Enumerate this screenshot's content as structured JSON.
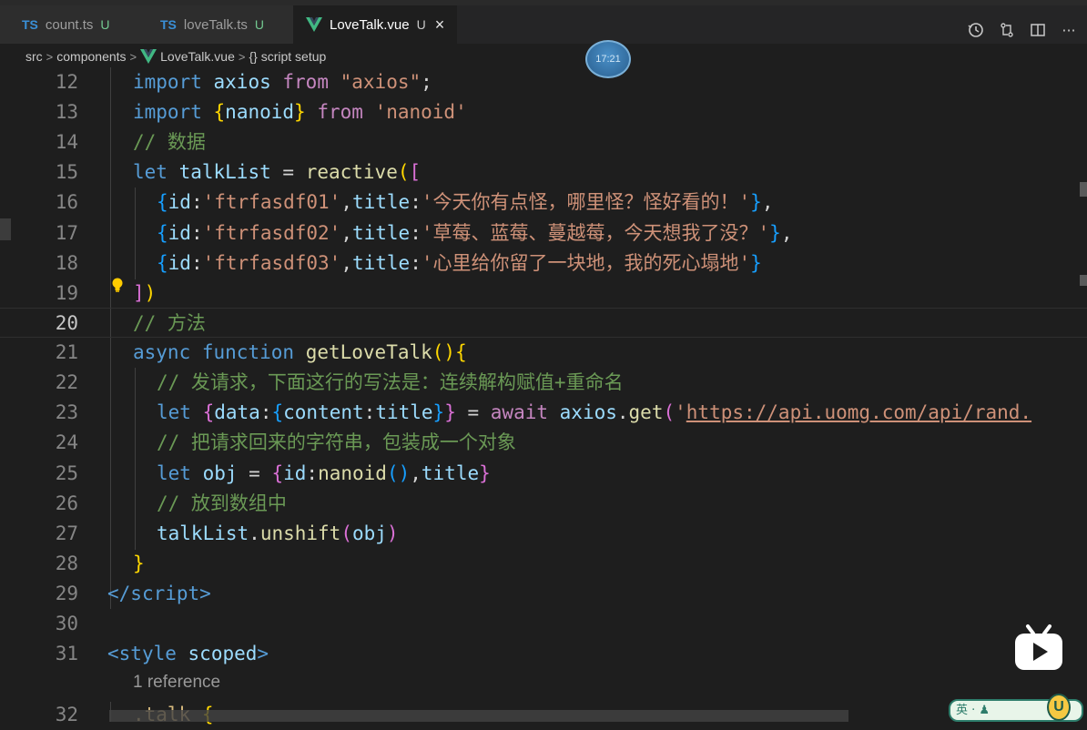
{
  "tabs": [
    {
      "icon": "ts",
      "badge": "TS",
      "label": "count.ts",
      "status": "U",
      "active": false
    },
    {
      "icon": "ts",
      "badge": "TS",
      "label": "loveTalk.ts",
      "status": "U",
      "active": false
    },
    {
      "icon": "vue",
      "badge": "",
      "label": "LoveTalk.vue",
      "status": "U",
      "active": true,
      "close": "×"
    }
  ],
  "tab_actions": [
    "timeline-icon",
    "compare-changes-icon",
    "split-editor-icon",
    "more-actions-icon"
  ],
  "more_actions_label": "···",
  "breadcrumb": {
    "segments": [
      "src",
      "components",
      "LoveTalk.vue",
      "{} script setup"
    ],
    "separator": ">"
  },
  "clock_bubble": "17:21",
  "code": {
    "current_line": 20,
    "lines": [
      {
        "n": "12",
        "tokens": [
          [
            "k",
            "import"
          ],
          [
            "p",
            " "
          ],
          [
            "v",
            "axios"
          ],
          [
            "p",
            " "
          ],
          [
            "c",
            "from"
          ],
          [
            "p",
            " "
          ],
          [
            "s",
            "\"axios\""
          ],
          [
            "p",
            ";"
          ]
        ]
      },
      {
        "n": "13",
        "tokens": [
          [
            "k",
            "import"
          ],
          [
            "p",
            " "
          ],
          [
            "b1",
            "{"
          ],
          [
            "v",
            "nanoid"
          ],
          [
            "b1",
            "}"
          ],
          [
            "p",
            " "
          ],
          [
            "c",
            "from"
          ],
          [
            "p",
            " "
          ],
          [
            "s",
            "'nanoid'"
          ]
        ]
      },
      {
        "n": "14",
        "tokens": [
          [
            "cm",
            "// 数据"
          ]
        ]
      },
      {
        "n": "15",
        "tokens": [
          [
            "k",
            "let"
          ],
          [
            "p",
            " "
          ],
          [
            "v",
            "talkList"
          ],
          [
            "p",
            " = "
          ],
          [
            "f",
            "reactive"
          ],
          [
            "b1",
            "("
          ],
          [
            "b2",
            "["
          ]
        ]
      },
      {
        "n": "16",
        "tokens": [
          [
            "b3",
            "{"
          ],
          [
            "v",
            "id"
          ],
          [
            "p",
            ":"
          ],
          [
            "s",
            "'ftrfasdf01'"
          ],
          [
            "p",
            ","
          ],
          [
            "v",
            "title"
          ],
          [
            "p",
            ":"
          ],
          [
            "s",
            "'今天你有点怪，哪里怪？怪好看的！'"
          ],
          [
            "b3",
            "}"
          ],
          [
            "p",
            ","
          ]
        ]
      },
      {
        "n": "17",
        "tokens": [
          [
            "b3",
            "{"
          ],
          [
            "v",
            "id"
          ],
          [
            "p",
            ":"
          ],
          [
            "s",
            "'ftrfasdf02'"
          ],
          [
            "p",
            ","
          ],
          [
            "v",
            "title"
          ],
          [
            "p",
            ":"
          ],
          [
            "s",
            "'草莓、蓝莓、蔓越莓，今天想我了没？'"
          ],
          [
            "b3",
            "}"
          ],
          [
            "p",
            ","
          ]
        ]
      },
      {
        "n": "18",
        "tokens": [
          [
            "b3",
            "{"
          ],
          [
            "v",
            "id"
          ],
          [
            "p",
            ":"
          ],
          [
            "s",
            "'ftrfasdf03'"
          ],
          [
            "p",
            ","
          ],
          [
            "v",
            "title"
          ],
          [
            "p",
            ":"
          ],
          [
            "s",
            "'心里给你留了一块地，我的死心塌地'"
          ],
          [
            "b3",
            "}"
          ]
        ]
      },
      {
        "n": "19",
        "tokens": [
          [
            "b2",
            "]"
          ],
          [
            "b1",
            ")"
          ]
        ]
      },
      {
        "n": "20",
        "tokens": [
          [
            "cm",
            "// 方法"
          ]
        ]
      },
      {
        "n": "21",
        "tokens": [
          [
            "k",
            "async"
          ],
          [
            "p",
            " "
          ],
          [
            "k",
            "function"
          ],
          [
            "p",
            " "
          ],
          [
            "f",
            "getLoveTalk"
          ],
          [
            "b1",
            "()"
          ],
          [
            "b1",
            "{"
          ]
        ]
      },
      {
        "n": "22",
        "tokens": [
          [
            "cm",
            "// 发请求，下面这行的写法是：连续解构赋值+重命名"
          ]
        ]
      },
      {
        "n": "23",
        "tokens": [
          [
            "k",
            "let"
          ],
          [
            "p",
            " "
          ],
          [
            "b2",
            "{"
          ],
          [
            "v",
            "data"
          ],
          [
            "p",
            ":"
          ],
          [
            "b3",
            "{"
          ],
          [
            "v",
            "content"
          ],
          [
            "p",
            ":"
          ],
          [
            "v",
            "title"
          ],
          [
            "b3",
            "}"
          ],
          [
            "b2",
            "}"
          ],
          [
            "p",
            " = "
          ],
          [
            "c",
            "await"
          ],
          [
            "p",
            " "
          ],
          [
            "v",
            "axios"
          ],
          [
            "p",
            "."
          ],
          [
            "f",
            "get"
          ],
          [
            "b2",
            "("
          ],
          [
            "s",
            "'"
          ],
          [
            "s link",
            "https://api.uomg.com/api/rand."
          ]
        ]
      },
      {
        "n": "24",
        "tokens": [
          [
            "cm",
            "// 把请求回来的字符串，包装成一个对象"
          ]
        ]
      },
      {
        "n": "25",
        "tokens": [
          [
            "k",
            "let"
          ],
          [
            "p",
            " "
          ],
          [
            "v",
            "obj"
          ],
          [
            "p",
            " = "
          ],
          [
            "b2",
            "{"
          ],
          [
            "v",
            "id"
          ],
          [
            "p",
            ":"
          ],
          [
            "f",
            "nanoid"
          ],
          [
            "b3",
            "()"
          ],
          [
            "p",
            ","
          ],
          [
            "v",
            "title"
          ],
          [
            "b2",
            "}"
          ]
        ]
      },
      {
        "n": "26",
        "tokens": [
          [
            "cm",
            "// 放到数组中"
          ]
        ]
      },
      {
        "n": "27",
        "tokens": [
          [
            "v",
            "talkList"
          ],
          [
            "p",
            "."
          ],
          [
            "f",
            "unshift"
          ],
          [
            "b2",
            "("
          ],
          [
            "v",
            "obj"
          ],
          [
            "b2",
            ")"
          ]
        ]
      },
      {
        "n": "28",
        "tokens": [
          [
            "b1",
            "}"
          ]
        ]
      },
      {
        "n": "29",
        "tokens": [
          [
            "tag",
            "</"
          ],
          [
            "tagname",
            "script"
          ],
          [
            "tag",
            ">"
          ]
        ]
      },
      {
        "n": "30",
        "tokens": []
      },
      {
        "n": "31",
        "tokens": [
          [
            "tag",
            "<"
          ],
          [
            "tagname",
            "style"
          ],
          [
            "p",
            " "
          ],
          [
            "attr",
            "scoped"
          ],
          [
            "tag",
            ">"
          ]
        ]
      },
      {
        "n": "32",
        "tokens": [
          [
            "sel",
            ".talk"
          ],
          [
            "p",
            " "
          ],
          [
            "b1",
            "{"
          ]
        ]
      }
    ]
  },
  "codelens": "1 reference",
  "overlay": {
    "ime_badge": "英 · ♟",
    "ime_letter": "U"
  },
  "colors": {
    "editor_bg": "#1e1e1e",
    "tabbar_bg": "#252526",
    "ts_badge": "#3a8fd6",
    "vue_green": "#41b883",
    "keyword": "#569cd6",
    "control": "#c586c0",
    "function": "#dcdcaa",
    "variable": "#9cdcfe",
    "string": "#ce9178",
    "comment": "#6a9955"
  }
}
